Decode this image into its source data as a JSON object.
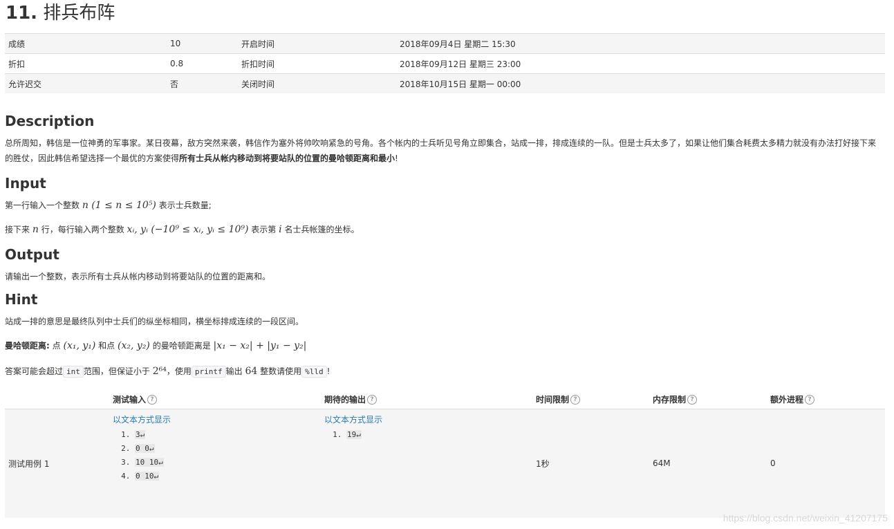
{
  "title": {
    "number": "11.",
    "text": "排兵布阵"
  },
  "info_rows": [
    {
      "label1": "成绩",
      "value1": "10",
      "label2": "开启时间",
      "value2": "2018年09月4日 星期二 15:30"
    },
    {
      "label1": "折扣",
      "value1": "0.8",
      "label2": "折扣时间",
      "value2": "2018年09月12日 星期三 23:00"
    },
    {
      "label1": "允许迟交",
      "value1": "否",
      "label2": "关闭时间",
      "value2": "2018年10月15日 星期一 00:00"
    }
  ],
  "description": {
    "heading": "Description",
    "text_a": "总所周知，韩信是一位神勇的军事家。某日夜幕，敌方突然来袭，韩信作为塞外将帅吹响紧急的号角。各个帐内的士兵听见号角立即集合，站成一排，排成连续的一队。但是士兵太多了，如果让他们集合耗费太多精力就没有办法打好接下来的胜仗，因此韩信希望选择一个最优的方案使得",
    "text_bold": "所有士兵从帐内移动到将要站队的位置的曼哈顿距离和最小",
    "text_end": "!"
  },
  "input": {
    "heading": "Input",
    "line1_a": "第一行输入一个整数",
    "line1_math": "n (1 ≤ n ≤ 10⁵)",
    "line1_b": "表示士兵数量;",
    "line2_a": "接下来",
    "line2_n": "n",
    "line2_b": "行，每行输入两个整数",
    "line2_math": "xᵢ, yᵢ (−10⁹ ≤ xᵢ, yᵢ ≤ 10⁹)",
    "line2_c": "表示第",
    "line2_i": "i",
    "line2_d": "名士兵帐篷的坐标。"
  },
  "output": {
    "heading": "Output",
    "text": "请输出一个整数，表示所有士兵从帐内移动到将要站队的位置的距离和。"
  },
  "hint": {
    "heading": "Hint",
    "line1": "站成一排的意思是最终队列中士兵们的纵坐标相同，横坐标排成连续的一段区间。",
    "line2_bold": "曼哈顿距离:",
    "line2_a": "点",
    "line2_p1": "(x₁, y₁)",
    "line2_b": "和点",
    "line2_p2": "(x₂, y₂)",
    "line2_c": "的曼哈顿距离是",
    "line2_formula": "|x₁ − x₂| + |y₁ − y₂|",
    "line3_a": "答案可能会超过",
    "line3_code1": "int",
    "line3_b": "范围，但保证小于",
    "line3_pow": "2⁶⁴",
    "line3_c": "，使用",
    "line3_code2": "printf",
    "line3_d": "输出",
    "line3_num": "64",
    "line3_e": "整数请使用",
    "line3_code3": "%lld",
    "line3_f": "!"
  },
  "cases_table": {
    "headers": [
      "测试输入",
      "期待的输出",
      "时间限制",
      "内存限制",
      "额外进程"
    ],
    "row_label": "测试用例 1",
    "input_link": "以文本方式显示",
    "input_lines": [
      "3↵",
      "0 0↵",
      "10 10↵",
      "0 10↵"
    ],
    "output_link": "以文本方式显示",
    "output_lines": [
      "19↵"
    ],
    "time_limit": "1秒",
    "memory_limit": "64M",
    "extra_process": "0"
  },
  "watermark": "https://blog.csdn.net/weixin_41207175"
}
